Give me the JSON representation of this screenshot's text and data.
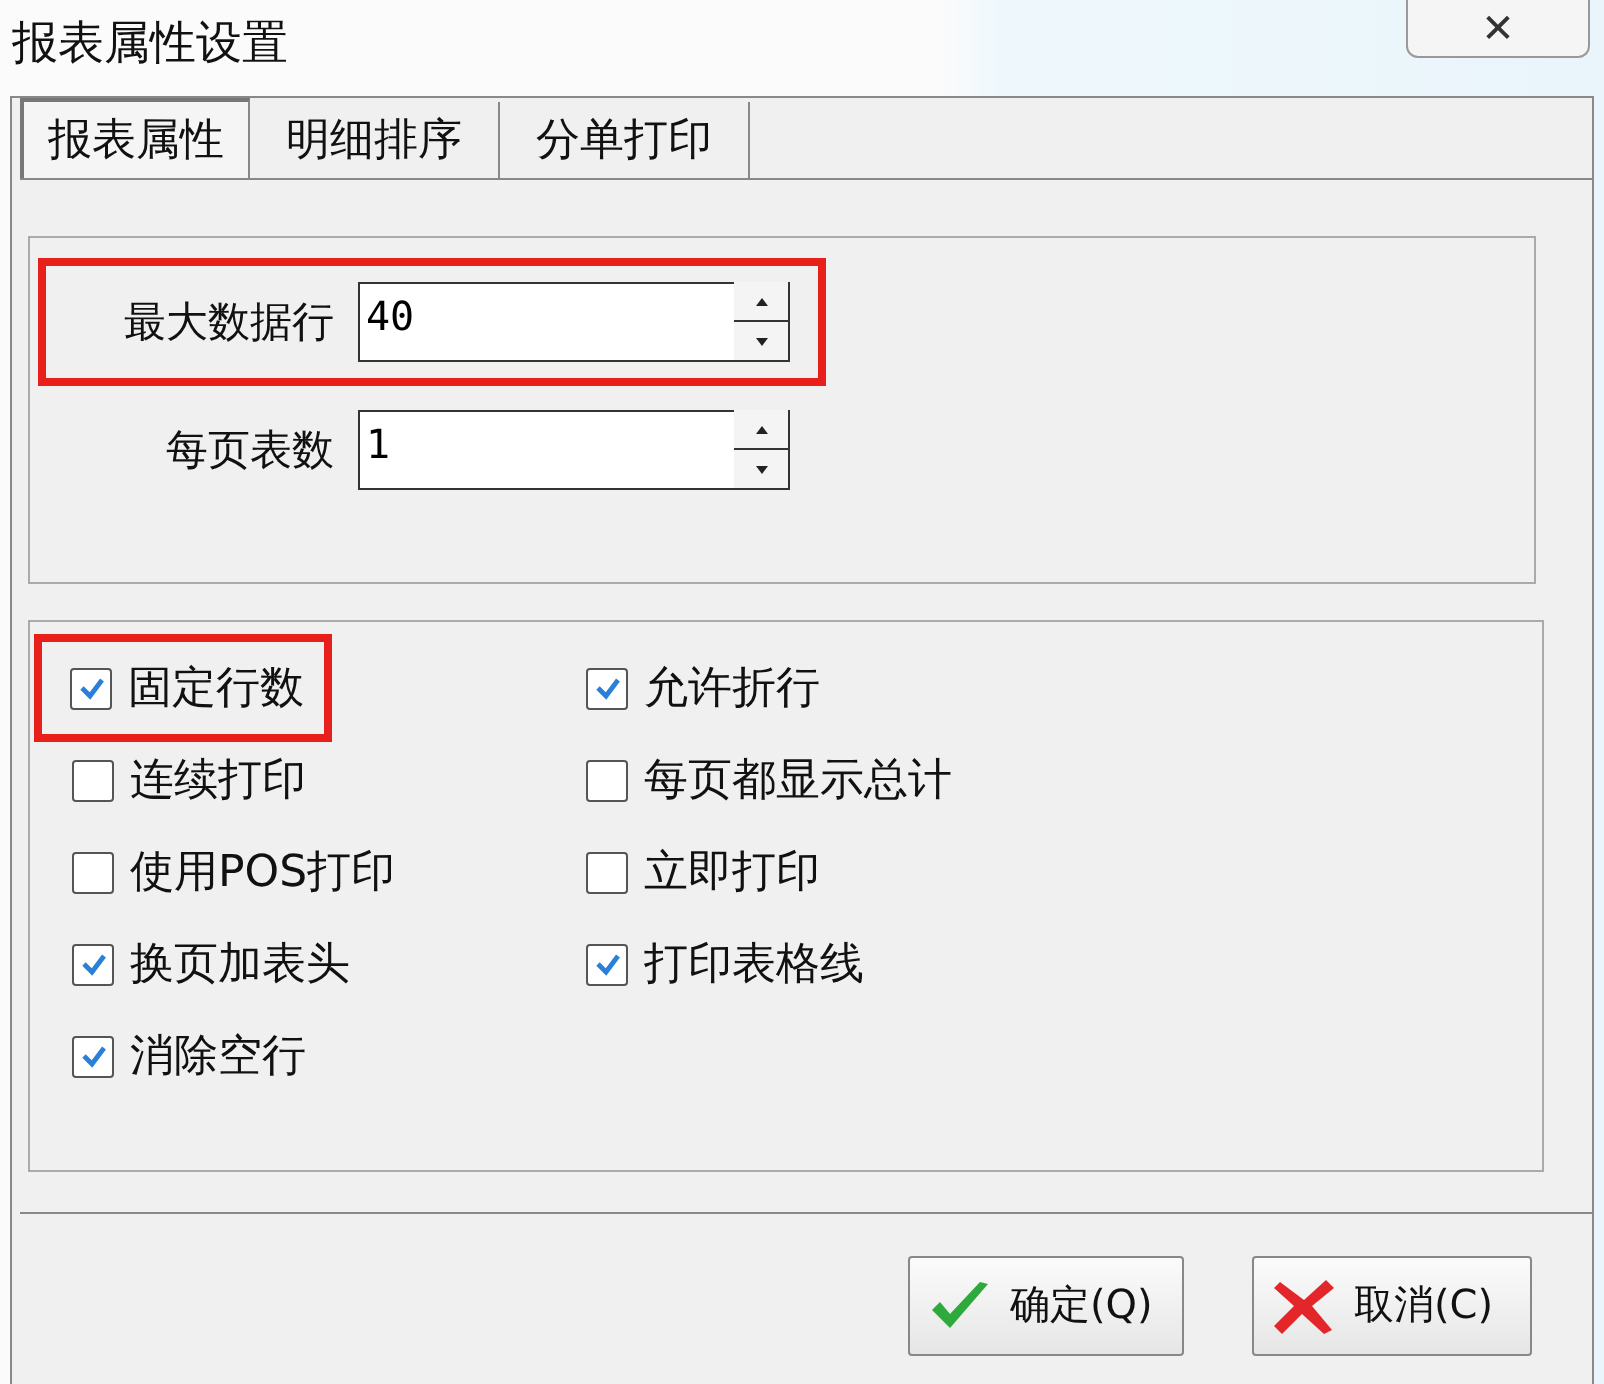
{
  "window": {
    "title": "报表属性设置",
    "close": "✕"
  },
  "tabs": [
    {
      "label": "报表属性",
      "selected": true
    },
    {
      "label": "明细排序",
      "selected": false
    },
    {
      "label": "分单打印",
      "selected": false
    }
  ],
  "fields": [
    {
      "label": "最大数据行",
      "value": "40",
      "highlighted": true
    },
    {
      "label": "每页表数",
      "value": "1",
      "highlighted": false
    }
  ],
  "options": [
    {
      "label": "固定行数",
      "checked": true,
      "highlighted": true
    },
    {
      "label": "允许折行",
      "checked": true,
      "highlighted": false
    },
    {
      "label": "连续打印",
      "checked": false,
      "highlighted": false
    },
    {
      "label": "每页都显示总计",
      "checked": false,
      "highlighted": false
    },
    {
      "label": "使用POS打印",
      "checked": false,
      "highlighted": false
    },
    {
      "label": "立即打印",
      "checked": false,
      "highlighted": false
    },
    {
      "label": "换页加表头",
      "checked": true,
      "highlighted": false
    },
    {
      "label": "打印表格线",
      "checked": true,
      "highlighted": false
    },
    {
      "label": "消除空行",
      "checked": true,
      "highlighted": false
    }
  ],
  "buttons": [
    {
      "kind": "ok",
      "label": "确定(Q)"
    },
    {
      "kind": "cancel",
      "label": "取消(C)"
    }
  ]
}
